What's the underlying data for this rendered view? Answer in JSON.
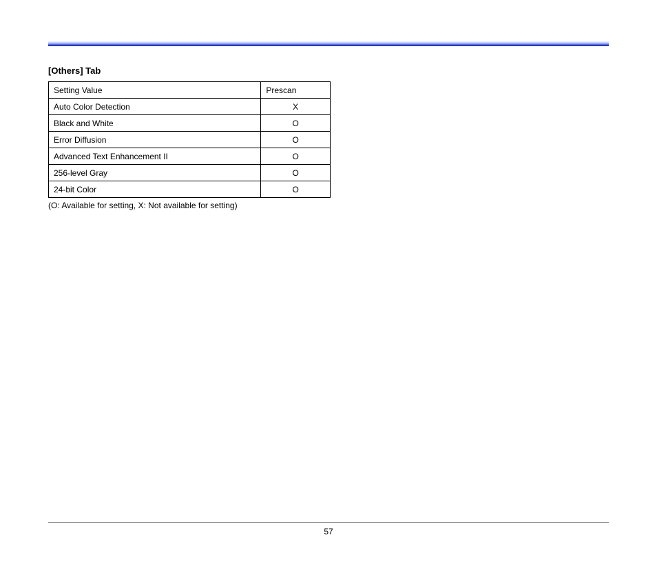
{
  "heading": "[Others] Tab",
  "table": {
    "header": {
      "col1": "Setting Value",
      "col2": "Prescan"
    },
    "rows": [
      {
        "label": "Auto Color Detection",
        "value": "X"
      },
      {
        "label": "Black and White",
        "value": "O"
      },
      {
        "label": "Error Diffusion",
        "value": "O"
      },
      {
        "label": "Advanced Text Enhancement II",
        "value": "O"
      },
      {
        "label": "256-level Gray",
        "value": "O"
      },
      {
        "label": "24-bit Color",
        "value": "O"
      }
    ]
  },
  "legend": "(O: Available for setting, X: Not available for setting)",
  "page_number": "57"
}
